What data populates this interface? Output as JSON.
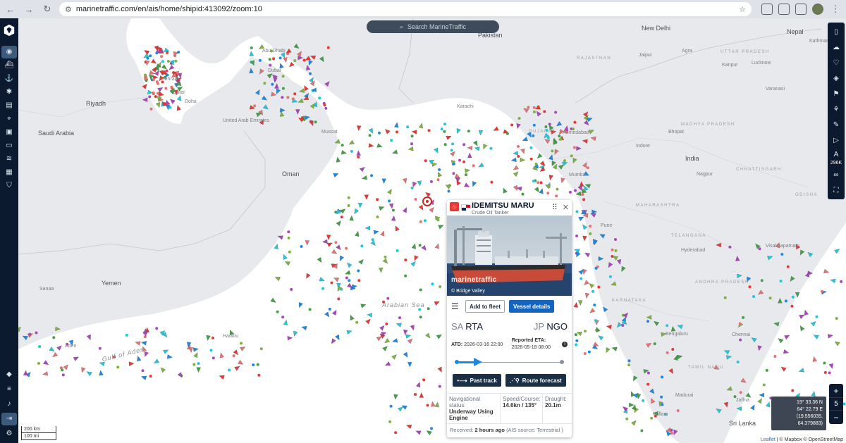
{
  "browser": {
    "url": "marinetraffic.com/en/ais/home/shipid:413092/zoom:10"
  },
  "search": {
    "placeholder": "Search MarineTraffic"
  },
  "map_labels": {
    "countries": [
      "Saudi Arabia",
      "Oman",
      "Yemen",
      "India",
      "Nepal",
      "New Delhi",
      "Pakistan",
      "United Arab Emirates",
      "Qatar",
      "Bahrain",
      "Riyadh",
      "Karachi",
      "Mumbai",
      "Dubai",
      "Abu Dhabi",
      "Doha",
      "Muscat",
      "Sanaa",
      "Aden",
      "Hyderabad",
      "Bhopal",
      "Bengaluru",
      "Chennai",
      "Pune",
      "Ahmedabad",
      "Jaipur",
      "Agra",
      "Kanpur",
      "Lucknow",
      "Varanasi",
      "Indore",
      "Nagpur",
      "Visakhapatnam",
      "Madurai",
      "Kollam",
      "Jaffna",
      "Sri Lanka",
      "Hadibu",
      "Gulf of Aden",
      "Arabian Sea",
      "Kathmandu"
    ],
    "regions": [
      "RAJASTHAN",
      "GUJARAT",
      "MADHYA PRADESH",
      "MAHARASHTRA",
      "TELANGANA",
      "ANDHRA PRADESH",
      "KARNATAKA",
      "TAMIL NADU",
      "ODISHA",
      "CHHATTISGARH",
      "UTTAR PRADESH"
    ]
  },
  "vessel": {
    "name": "IDEMITSU MARU",
    "type": "Crude Oil Tanker",
    "photo_credit": "© Bridge Valley",
    "photo_mark": "marinetraffic",
    "add_to_fleet": "Add to fleet",
    "vessel_details": "Vessel details",
    "origin_cc": "SA",
    "origin_port": "RTA",
    "dest_cc": "JP",
    "dest_port": "NGO",
    "atd_label": "ATD:",
    "atd_value": "2026-03-16 22:00",
    "eta_label": "Reported ETA:",
    "eta_value": "2026-05-18 08:00",
    "progress": 0.2,
    "past_track": "Past track",
    "route_forecast": "Route forecast",
    "nav_status_label": "Navigational status:",
    "nav_status_value": "Underway Using Engine",
    "speed_label": "Speed/Course:",
    "speed_value": "14.6kn / 135°",
    "draught_label": "Draught:",
    "draught_value": "20.1m",
    "received_label": "Received:",
    "received_value": "2 hours ago",
    "received_source": "(AIS source: Terrestrial )"
  },
  "right_toolbar": {
    "vessel_count": "296K"
  },
  "zoom": {
    "plus": "+",
    "level": "5",
    "minus": "−"
  },
  "coords": {
    "lat": "19° 33.36 N",
    "lon": "64° 22.79 E",
    "decimal": "(19.556035, 64.379883)"
  },
  "scale": {
    "km": "200 km",
    "mi": "100 mi"
  },
  "attribution": {
    "leaflet": "Leaflet",
    "rest": "| © Mapbox © OpenStreetMap"
  },
  "colors": {
    "sidebar": "#0b1a2e",
    "accent": "#1565c0",
    "land": "#e7e9ec",
    "sea": "#ffffff",
    "tanker": "#e53935",
    "cargo": "#43a047",
    "passenger": "#1e88e5"
  }
}
